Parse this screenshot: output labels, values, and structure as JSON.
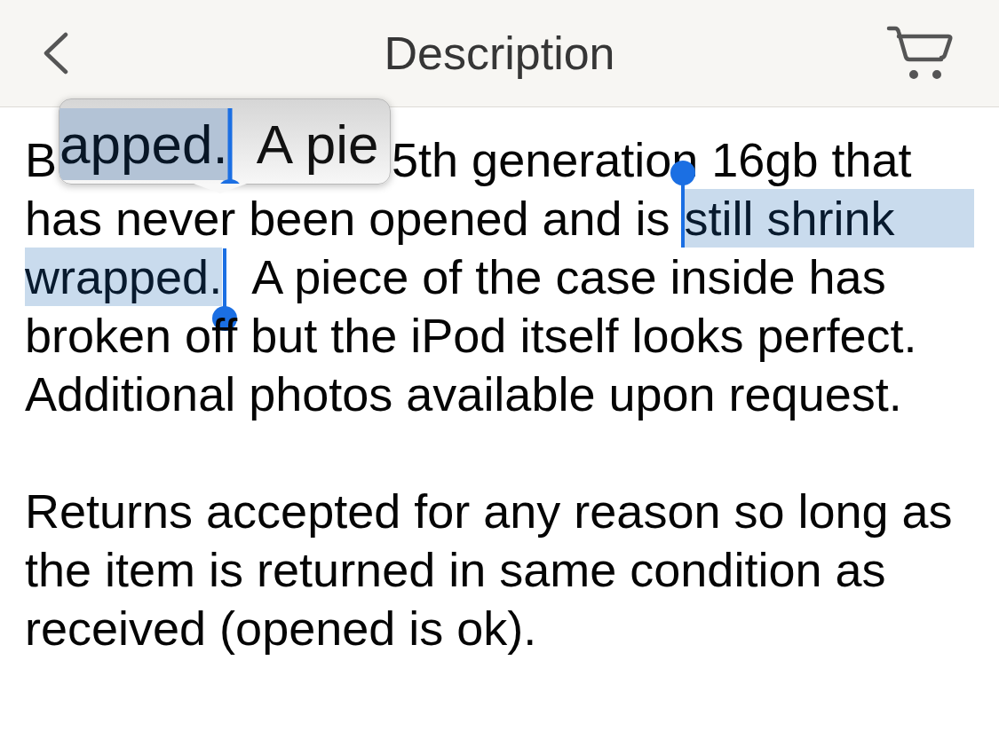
{
  "nav_bar": {
    "title": "Description"
  },
  "loupe": {
    "segments": [
      {
        "text": "apped.",
        "selected": true
      },
      {
        "text": "A pie",
        "selected": false
      }
    ]
  },
  "description": {
    "paragraphs": [
      {
        "lines": [
          {
            "segments": [
              {
                "text": "B",
                "selected": false
              }
            ],
            "after_loupe": [
              {
                "text": "5th generation 16gb that",
                "selected": false
              }
            ]
          },
          {
            "segments": [
              {
                "text": "has never been opened and is",
                "selected": false
              },
              {
                "text": "still shrink",
                "selected": true
              }
            ]
          },
          {
            "segments": [
              {
                "text": "wrapped.",
                "selected": true
              },
              {
                "text": "A piece of the case inside has",
                "selected": false
              }
            ]
          },
          {
            "segments": [
              {
                "text": "broken off but the iPod itself looks perfect.",
                "selected": false
              }
            ]
          },
          {
            "segments": [
              {
                "text": "Additional photos available upon request.",
                "selected": false
              }
            ]
          }
        ]
      },
      {
        "lines": [
          {
            "segments": [
              {
                "text": "Returns accepted for any reason so long as",
                "selected": false
              }
            ]
          },
          {
            "segments": [
              {
                "text": "the item is returned in same condition as",
                "selected": false
              }
            ]
          },
          {
            "segments": [
              {
                "text": "received (opened is ok).",
                "selected": false
              }
            ]
          }
        ]
      }
    ]
  }
}
